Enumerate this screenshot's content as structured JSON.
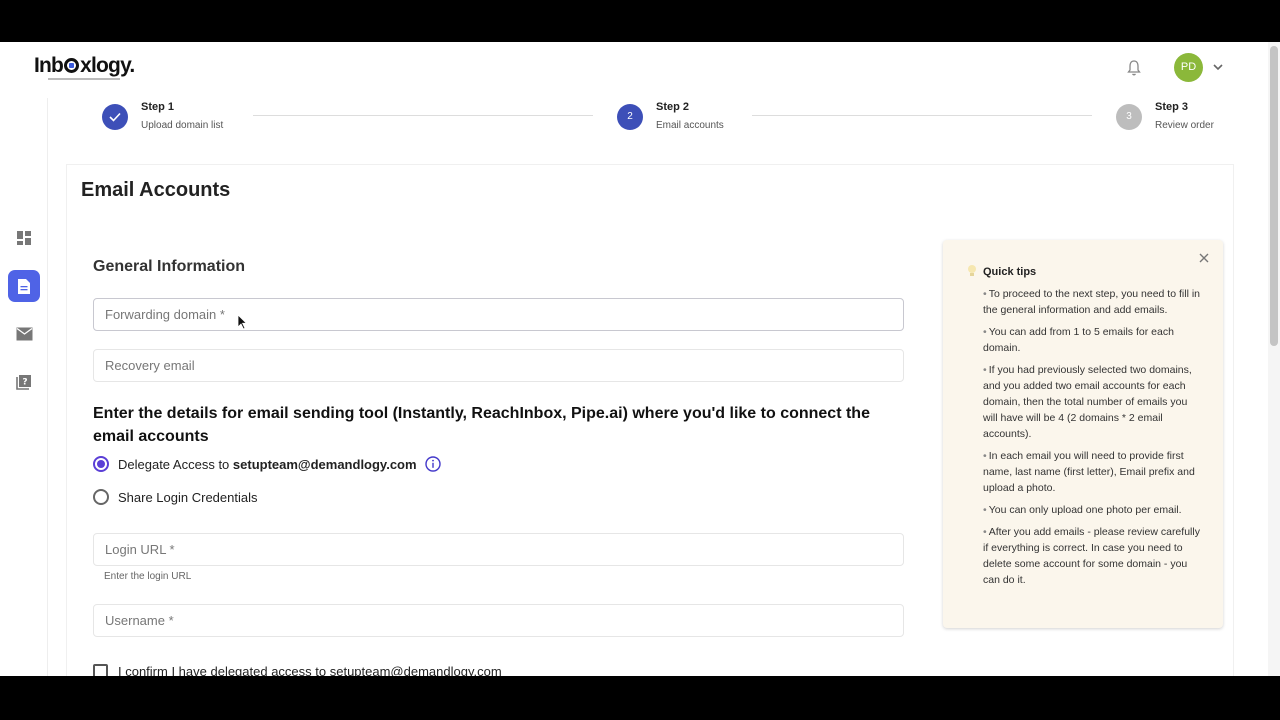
{
  "header": {
    "logo_text_pre": "Inb",
    "logo_text_post": "xlogy.",
    "avatar_initials": "PD"
  },
  "steps": [
    {
      "title": "Step 1",
      "subtitle": "Upload domain list",
      "number": "✓",
      "status": "done",
      "color": "#3d4fb8"
    },
    {
      "title": "Step 2",
      "subtitle": "Email accounts",
      "number": "2",
      "status": "current",
      "color": "#3d4fb8"
    },
    {
      "title": "Step 3",
      "subtitle": "Review order",
      "number": "3",
      "status": "pending",
      "color": "#bdbdbd"
    }
  ],
  "page": {
    "title": "Email Accounts",
    "section_title": "General Information",
    "forwarding_placeholder": "Forwarding domain *",
    "recovery_placeholder": "Recovery email",
    "tool_title": "Enter the details for email sending tool (Instantly, ReachInbox, Pipe.ai) where you'd like to connect the email accounts",
    "radio_delegate_prefix": "Delegate Access to ",
    "radio_delegate_email": "setupteam@demandlogy.com",
    "radio_share": "Share Login Credentials",
    "login_url_placeholder": "Login URL *",
    "login_url_helper": "Enter the login URL",
    "username_placeholder": "Username *",
    "confirm_label": "I confirm I have delegated access to setupteam@demandlogy.com"
  },
  "tips": {
    "title": "Quick tips",
    "items": [
      "To proceed to the next step, you need to fill in the general information and add emails.",
      "You can add from 1 to 5 emails for each domain.",
      "If you had previously selected two domains, and you added two email accounts for each domain, then the total number of emails you will have will be 4 (2 domains * 2 email accounts).",
      "In each email you will need to provide first name, last name (first letter), Email prefix and upload a photo.",
      "You can only upload one photo per email.",
      "After you add emails - please review carefully if everything is correct. In case you need to delete some account for some domain - you can do it."
    ]
  },
  "colors": {
    "accent": "#4f63e6",
    "radio": "#5b3fd6",
    "tips_bg": "#fbf6ec",
    "avatar": "#8bb83a"
  }
}
